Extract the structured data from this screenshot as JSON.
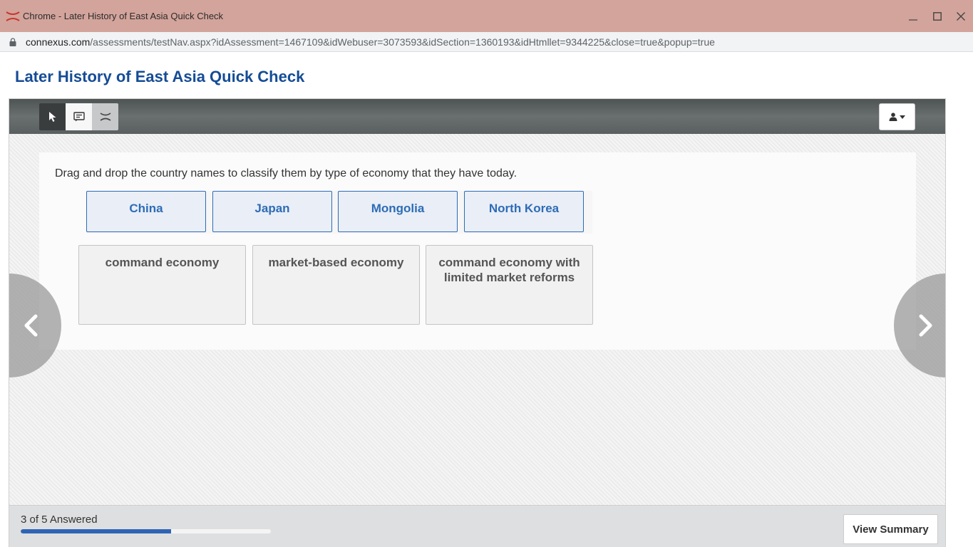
{
  "window": {
    "title": "Chrome - Later History of East Asia Quick Check",
    "icon": "connexus-x-icon"
  },
  "address_bar": {
    "host": "connexus.com",
    "path": "/assessments/testNav.aspx?idAssessment=1467109&idWebuser=3073593&idSection=1360193&idHtmllet=9344225&close=true&popup=true"
  },
  "page": {
    "title": "Later History of East Asia Quick Check"
  },
  "toolbar": {
    "tools": [
      "pointer-icon",
      "notes-icon",
      "eliminate-icon"
    ],
    "user_menu_icon": "user-icon"
  },
  "question": {
    "prompt": "Drag and drop the country names to classify them by type of economy that they have today.",
    "options": [
      "China",
      "Japan",
      "Mongolia",
      "North Korea"
    ],
    "categories": [
      "command economy",
      "market-based economy",
      "command economy with limited market reforms"
    ]
  },
  "footer": {
    "progress_text": "3 of 5 Answered",
    "progress_fraction": 0.6,
    "summary_label": "View Summary"
  },
  "colors": {
    "titlebar": "#d3a49b",
    "page_title": "#154c96",
    "chip_text": "#2e6cb5",
    "progress_fill": "#2f64b5"
  }
}
